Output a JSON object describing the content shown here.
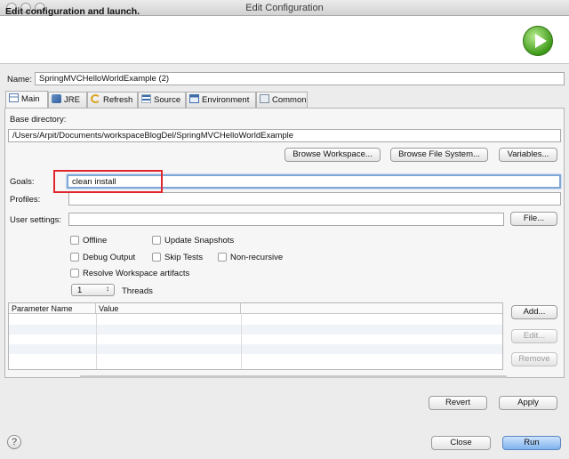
{
  "window": {
    "title": "Edit Configuration"
  },
  "header": {
    "title": "Edit configuration and launch.",
    "icon": "run-launch-icon"
  },
  "name": {
    "label": "Name:",
    "value": "SpringMVCHelloWorldExample (2)"
  },
  "tabs": [
    {
      "label": "Main",
      "icon": "main-tab-icon",
      "active": true
    },
    {
      "label": "JRE",
      "icon": "jre-icon"
    },
    {
      "label": "Refresh",
      "icon": "refresh-icon"
    },
    {
      "label": "Source",
      "icon": "source-icon"
    },
    {
      "label": "Environment",
      "icon": "environment-icon"
    },
    {
      "label": "Common",
      "icon": "common-icon"
    }
  ],
  "main": {
    "base_dir_label": "Base directory:",
    "base_dir_value": "/Users/Arpit/Documents/workspaceBlogDel/SpringMVCHelloWorldExample",
    "browse_workspace": "Browse Workspace...",
    "browse_fs": "Browse File System...",
    "variables": "Variables...",
    "goals_label": "Goals:",
    "goals_value": "clean install",
    "profiles_label": "Profiles:",
    "profiles_value": "",
    "user_settings_label": "User settings:",
    "user_settings_value": "",
    "file_button": "File...",
    "options": {
      "offline": "Offline",
      "update_snapshots": "Update Snapshots",
      "debug_output": "Debug Output",
      "skip_tests": "Skip Tests",
      "non_recursive": "Non-recursive",
      "resolve_workspace": "Resolve Workspace artifacts"
    },
    "threads_value": "1",
    "threads_label": "Threads",
    "table": {
      "col_name": "Parameter Name",
      "col_value": "Value"
    },
    "add": "Add...",
    "edit": "Edit...",
    "remove": "Remove"
  },
  "footer": {
    "revert": "Revert",
    "apply": "Apply",
    "close": "Close",
    "run": "Run",
    "help": "?"
  },
  "colors": {
    "annotation": "#e0262c",
    "run_button": "#7fb2ee",
    "focus": "#7ea7d8"
  }
}
